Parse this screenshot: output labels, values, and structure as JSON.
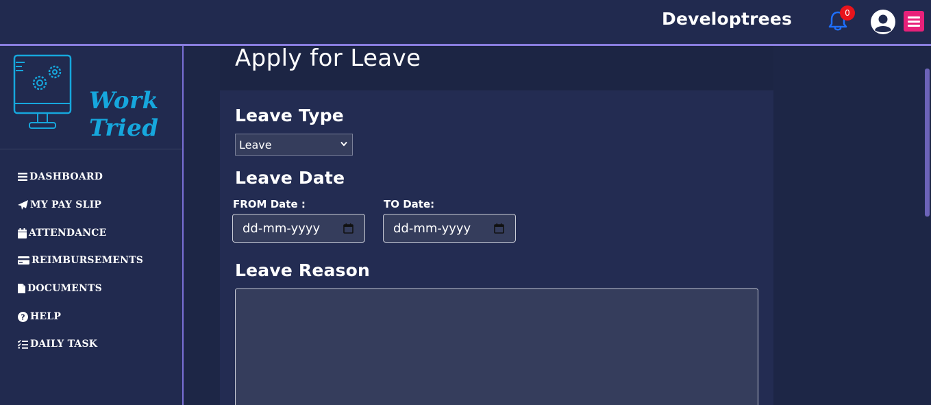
{
  "topbar": {
    "company_name": "Developtrees",
    "notification_count": "0",
    "colors": {
      "background": "#212a4f",
      "bell": "#1e6fff",
      "badge": "#e8141c",
      "menu_button": "#e8217a"
    }
  },
  "sidebar": {
    "logo_text": "Work Tried",
    "items": [
      {
        "label": "DASHBOARD",
        "icon": "list-icon"
      },
      {
        "label": "MY PAY SLIP",
        "icon": "paper-plane-icon"
      },
      {
        "label": "ATTENDANCE",
        "icon": "calendar-icon"
      },
      {
        "label": "REIMBURSEMENTS",
        "icon": "credit-card-icon"
      },
      {
        "label": "DOCUMENTS",
        "icon": "file-icon"
      },
      {
        "label": "HELP",
        "icon": "question-circle-icon"
      },
      {
        "label": "DAILY TASK",
        "icon": "tasks-icon"
      }
    ]
  },
  "main": {
    "page_title": "Apply for Leave",
    "leave_type": {
      "title": "Leave Type",
      "selected": "Leave"
    },
    "leave_date": {
      "title": "Leave Date",
      "from_label": "FROM Date :",
      "from_value": "dd-mm-yyyy",
      "to_label": "TO Date:",
      "to_value": "dd-mm-yyyy"
    },
    "leave_reason": {
      "title": "Leave Reason",
      "value": ""
    }
  }
}
